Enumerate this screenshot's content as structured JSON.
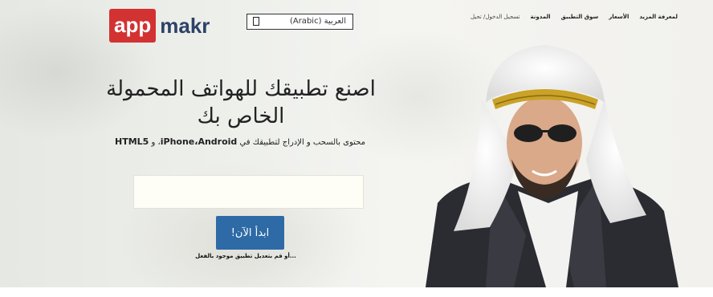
{
  "brand": {
    "logo_part1": "app",
    "logo_part2": "makr"
  },
  "language": {
    "selected": "العربية (Arabic)"
  },
  "nav": {
    "login": "تسجيل الدخول/ تحيل",
    "items": [
      "المدونة",
      "سوق التطبيق",
      "الأسعار",
      "لمعرفة المزيد"
    ]
  },
  "hero": {
    "title_line1": "اصنع تطبيقك للهواتف المحمولة",
    "title_line2": "الخاص بك",
    "subtitle_prefix": "محتوى بالسحب و الإدراج لتطبيقك في ",
    "subtitle_bold": "iPhone،Android",
    "subtitle_mid": "، و ",
    "subtitle_bold2": "HTML5",
    "input_value": "",
    "start_button": "ابدأ الآن!",
    "edit_link": "...أو قم بتعديل تطبيق موجود بالفعل"
  },
  "colors": {
    "logo_red": "#d33232",
    "logo_navy": "#2d4267",
    "button_blue": "#2e6aa6"
  },
  "icons": {
    "select_checkbox": "checkbox-icon"
  }
}
